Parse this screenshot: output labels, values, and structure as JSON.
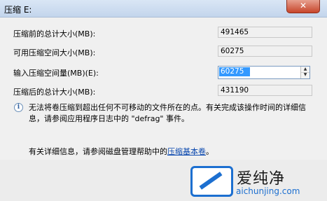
{
  "window": {
    "title": "压缩 E:",
    "close_symbol": "✕"
  },
  "rows": [
    {
      "label": "压缩前的总计大小(MB):",
      "value": "491465"
    },
    {
      "label": "可用压缩空间大小(MB):",
      "value": "60275"
    },
    {
      "label": "输入压缩空间量(MB)(E):",
      "value": "60275"
    },
    {
      "label": "压缩后的总计大小(MB):",
      "value": "431190"
    }
  ],
  "info": {
    "icon": "info-icon",
    "text": "无法将卷压缩到超出任何不可移动的文件所在的点。有关完成该操作时间的详细信息，请参阅应用程序日志中的 \"defrag\" 事件。"
  },
  "help": {
    "prefix": "有关详细信息，请参阅磁盘管理帮助中的",
    "link": "压缩基本卷",
    "suffix": "。"
  },
  "watermark": {
    "title": "爱纯净",
    "url": "aichunjing.com"
  },
  "colors": {
    "selection": "#3399ff",
    "link": "#0645ad",
    "brand": "#1c6fd0"
  }
}
